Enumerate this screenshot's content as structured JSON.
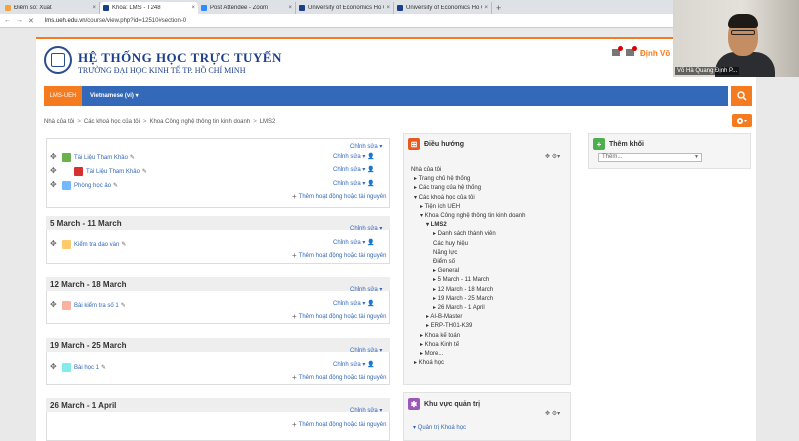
{
  "browser": {
    "tabs": [
      {
        "label": "Điểm số: Xuất",
        "color": "#f4a340"
      },
      {
        "label": "Khóa: LMS - T248",
        "color": "#1d3f8a",
        "active": true
      },
      {
        "label": "Post Attendee - Zoom",
        "color": "#2d8cff"
      },
      {
        "label": "University of Economics Ho Chi M",
        "color": "#1d3f8a"
      },
      {
        "label": "University of Economics Ho Chi M",
        "color": "#1d3f8a"
      }
    ],
    "url_prefix": "lms.ueh.edu.vn",
    "url_rest": "/course/view.php?id=12510#section-0"
  },
  "header": {
    "title": "HỆ THỐNG HỌC TRỰC TUYẾN",
    "subtitle": "TRƯỜNG ĐẠI HỌC KINH TẾ TP. HỒ CHÍ MINH",
    "user": "Định Võ"
  },
  "nav": {
    "lms": "LMS-UEH",
    "lang": "Vietnamese (vi) ▾"
  },
  "breadcrumb": [
    "Nhà của tôi",
    "Các khoá học của tôi",
    "Khoa Công nghệ thông tin kinh doanh",
    "LMS2"
  ],
  "labels": {
    "edit": "Chỉnh sửa ▾",
    "add": "Thêm hoạt động hoặc tài nguyên"
  },
  "section0": {
    "items": [
      "Tài Liệu Tham Khảo",
      "Tài Liệu Tham Khảo",
      "Phòng học ảo"
    ]
  },
  "sections": [
    {
      "title": "5 March - 11 March",
      "item": "Kiểm tra dao vàn"
    },
    {
      "title": "12 March - 18 March",
      "item": "Bài kiểm tra số 1"
    },
    {
      "title": "19 March - 25 March",
      "item": "Bài học 1"
    },
    {
      "title": "26 March - 1 April",
      "item": ""
    }
  ],
  "nav_block": {
    "title": "Điều hướng",
    "tree": [
      "Nhà của tôi",
      "▸ Trang chủ hệ thống",
      "▸ Các trang của hệ thống",
      "▾ Các khoá học của tôi",
      "▸ Tiện ích UEH",
      "▾ Khoa Công nghệ thông tin kinh doanh",
      "▾ LMS2",
      "▸ Danh sách thành viên",
      "Các huy hiệu",
      "Năng lực",
      "Điểm số",
      "▸ General",
      "▸ 5 March - 11 March",
      "▸ 12 March - 18 March",
      "▸ 19 March - 25 March",
      "▸ 26 March - 1 April",
      "▸ AI-B-Master",
      "▸ ERP-TH01-K39",
      "▸ Khoa kế toán",
      "▸ Khoa Kinh tế",
      "▸ More...",
      "▸ Khoá học"
    ]
  },
  "add_block": {
    "title": "Thêm khối",
    "placeholder": "Thêm..."
  },
  "admin_block": {
    "title": "Khu vực quản trị",
    "tree": [
      "▾ Quản trị Khoá học"
    ]
  },
  "video": {
    "caption": "Võ Hà Quang Định P..."
  },
  "colors": {
    "accent": "#f47b20",
    "navbar": "#3468b8",
    "brand": "#1d3f8a"
  }
}
